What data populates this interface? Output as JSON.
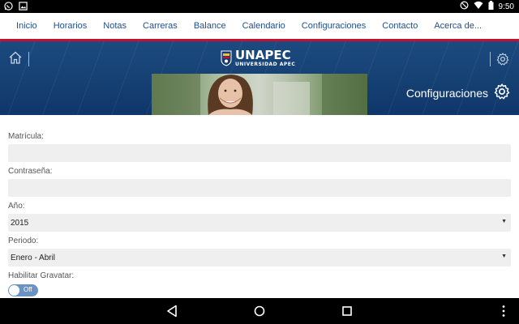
{
  "status_bar": {
    "time": "9:50",
    "icons_left": [
      "whatsapp-icon",
      "image-icon"
    ],
    "icons_right": [
      "do-not-disturb-icon",
      "wifi-icon",
      "battery-icon"
    ]
  },
  "top_nav": {
    "items": [
      {
        "label": "Inicio"
      },
      {
        "label": "Horarios"
      },
      {
        "label": "Notas"
      },
      {
        "label": "Carreras"
      },
      {
        "label": "Balance"
      },
      {
        "label": "Calendario"
      },
      {
        "label": "Configuraciones"
      },
      {
        "label": "Contacto"
      },
      {
        "label": "Acerca de..."
      }
    ],
    "text_color": "#1f4f8f",
    "accent_color": "#c8102e"
  },
  "header": {
    "logo_main": "UNAPEC",
    "logo_sub": "UNIVERSIDAD APEC",
    "page_title": "Configuraciones",
    "background_color": "#164273"
  },
  "form": {
    "matricula": {
      "label": "Matrícula:",
      "value": ""
    },
    "password": {
      "label": "Contraseña:",
      "value": ""
    },
    "year": {
      "label": "Año:",
      "value": "2015"
    },
    "period": {
      "label": "Periodo:",
      "value": "Enero - Abril"
    },
    "gravatar": {
      "label": "Habilitar Gravatar:",
      "toggle_text": "Off",
      "enabled": false
    }
  },
  "nav_bar": {
    "buttons": [
      "back-icon",
      "home-icon",
      "recents-icon",
      "more-icon"
    ]
  }
}
